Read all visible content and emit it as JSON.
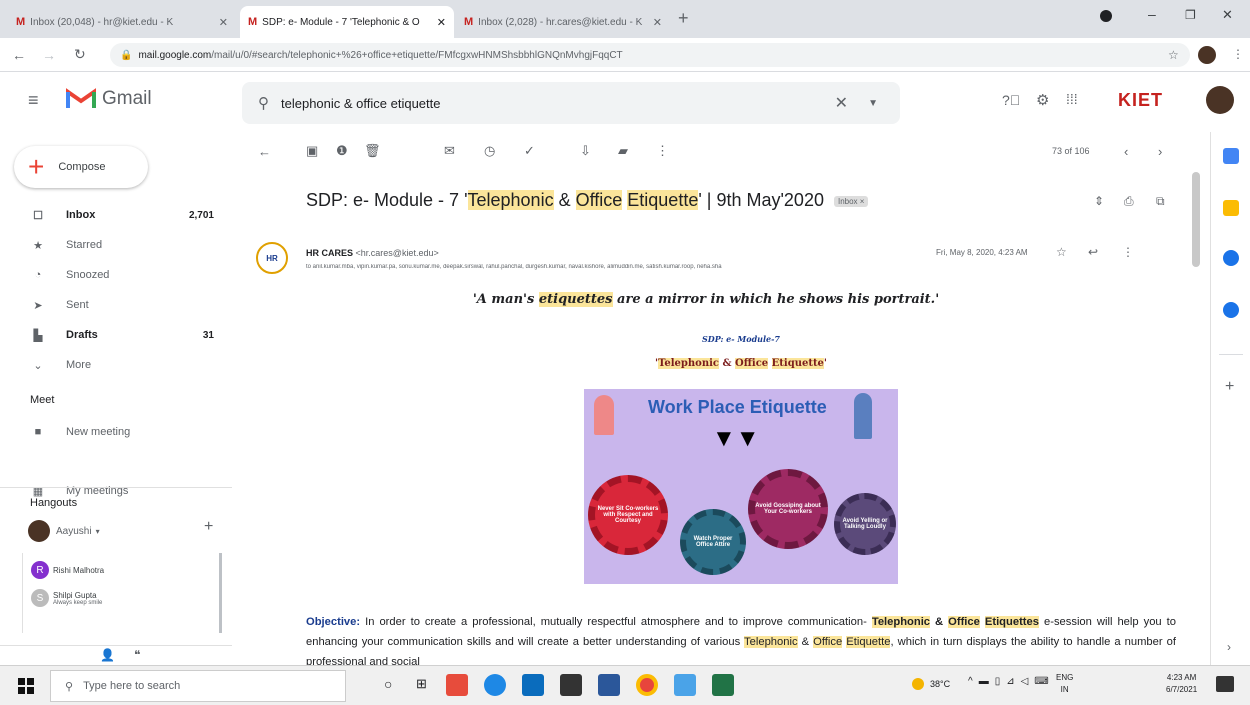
{
  "tabs": [
    {
      "label": "Inbox (20,048) - hr@kiet.edu - K",
      "active": false
    },
    {
      "label": "SDP: e- Module - 7 'Telephonic & O",
      "active": true
    },
    {
      "label": "Inbox (2,028) - hr.cares@kiet.edu - K",
      "active": false
    }
  ],
  "address": {
    "domain": "mail.google.com",
    "path": "/mail/u/0/#search/telephonic+%26+office+etiquette/FMfcgxwHNMShsbbhlGNQnMvhgjFqqCT"
  },
  "gmail": {
    "name": "Gmail",
    "search_value": "telephonic & office etiquette",
    "brand": "KIET"
  },
  "compose": "Compose",
  "nav": [
    {
      "label": "Inbox",
      "count": "2,701",
      "icon": "inbox-icon",
      "glyph": "☐",
      "bold": true
    },
    {
      "label": "Starred",
      "count": "",
      "icon": "star-icon",
      "glyph": "★",
      "bold": false
    },
    {
      "label": "Snoozed",
      "count": "",
      "icon": "clock-icon",
      "glyph": "◔",
      "bold": false
    },
    {
      "label": "Sent",
      "count": "",
      "icon": "send-icon",
      "glyph": "➤",
      "bold": false
    },
    {
      "label": "Drafts",
      "count": "31",
      "icon": "draft-icon",
      "glyph": "▙",
      "bold": true
    },
    {
      "label": "More",
      "count": "",
      "icon": "chevron-down-icon",
      "glyph": "⌄",
      "bold": false
    }
  ],
  "meet": {
    "title": "Meet",
    "new_meeting": "New meeting",
    "my_meetings": "My meetings"
  },
  "hangouts": {
    "title": "Hangouts",
    "user": "Aayushi",
    "contacts": [
      {
        "name": "Rishi Malhotra",
        "status": "",
        "initial": "R"
      },
      {
        "name": "Shilpi Gupta",
        "status": "Always keep smile",
        "initial": "S"
      }
    ]
  },
  "toolbar": {
    "count": "73 of 106"
  },
  "email": {
    "subject_parts": [
      "SDP: e- Module - 7 '",
      "Telephonic",
      " & ",
      "Office",
      " ",
      "Etiquette",
      "' | 9th May'2020"
    ],
    "label": "Inbox ×",
    "sender_name": "HR CARES",
    "sender_email": "<hr.cares@kiet.edu>",
    "date": "Fri, May 8, 2020, 4:23 AM",
    "recipients": "to anil.kumar.mba, vipin.kumar.pa, sonu.kumar.me, deepak.sirswal, rahul.panchal, durgesh.kumar, naval.kishore, alimuddin.me, satish.kumar.roop, neha.sha",
    "quote_parts": [
      "'A man's ",
      "etiquettes",
      " are a mirror in which he shows his portrait.'"
    ],
    "module": "SDP: e- Module-7",
    "heading_parts": [
      "'",
      "Telephonic",
      " & ",
      "Office",
      " ",
      "Etiquette",
      "'"
    ],
    "poster": {
      "title": "Work Place Etiquette",
      "gears": [
        "Never Sit Co-workers with Respect and Courtesy",
        "Watch Proper Office Attire",
        "Avoid Gossiping about Your Co-workers",
        "Avoid Yelling or Talking Loudly"
      ]
    },
    "objective_label": "Objective:",
    "body_parts": [
      " In order to create a professional, mutually respectful atmosphere and to improve communication- ",
      "Telephonic",
      " & ",
      "Office",
      " ",
      "Etiquettes",
      " e-session will help you to enhancing your communication skills and will create a better understanding of various ",
      "Telephonic",
      " & ",
      "Office",
      " ",
      "Etiquette",
      ", which in turn displays the ability to handle a number of professional and social"
    ]
  },
  "taskbar": {
    "search_placeholder": "Type here to search",
    "weather": "38°C",
    "lang1": "ENG",
    "lang2": "IN",
    "time": "4:23 AM",
    "date": "6/7/2021"
  }
}
